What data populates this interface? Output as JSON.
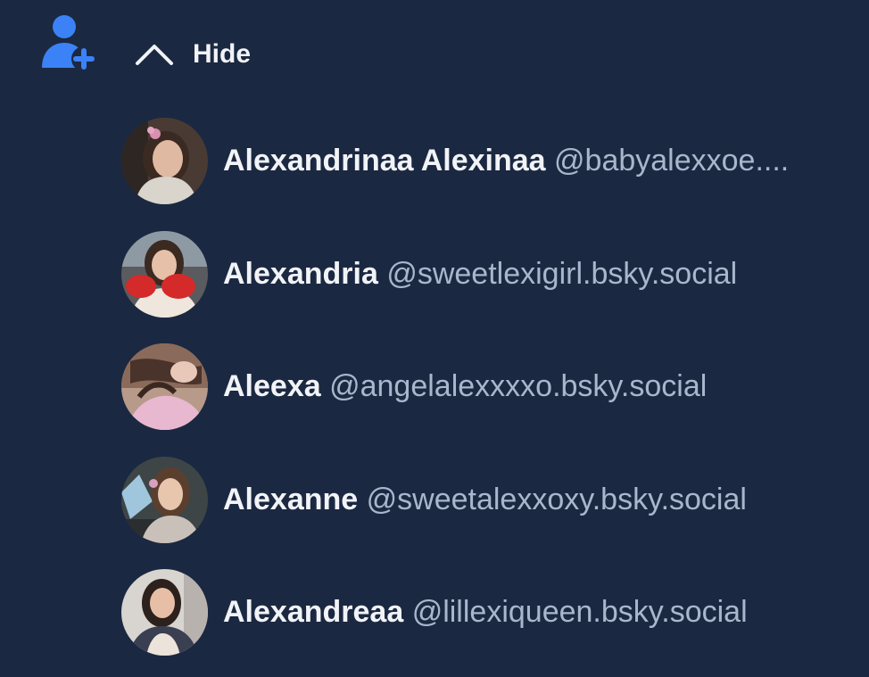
{
  "header": {
    "follow_icon": "person-plus-icon",
    "toggle_icon": "chevron-up-icon",
    "hide_label": "Hide",
    "accent_color": "#3b82f6"
  },
  "suggestions": [
    {
      "display_name": "Alexandrinaa Alexinaa",
      "handle": "@babyalexxoe...."
    },
    {
      "display_name": "Alexandria",
      "handle": "@sweetlexigirl.bsky.social"
    },
    {
      "display_name": "Aleexa",
      "handle": "@angelalexxxxo.bsky.social"
    },
    {
      "display_name": "Alexanne",
      "handle": "@sweetalexxoxy.bsky.social"
    },
    {
      "display_name": "Alexandreaa",
      "handle": "@lillexiqueen.bsky.social"
    }
  ],
  "colors": {
    "background": "#1b2841",
    "text_primary": "#f1f3f7",
    "text_secondary": "#a9b6cb"
  }
}
